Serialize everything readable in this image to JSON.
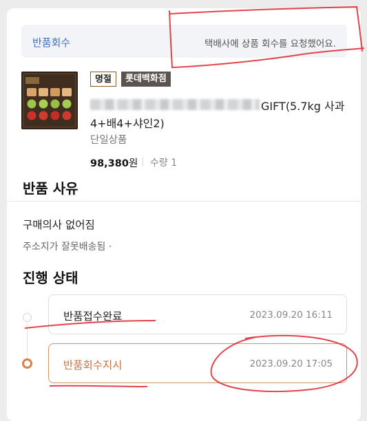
{
  "notice": {
    "label": "반품회수",
    "message": "택배사에 상품 회수를 요청했어요."
  },
  "product": {
    "thumbnail_icon": "gift-box-photo",
    "badges": {
      "brand": "명절",
      "store": "롯데백화점"
    },
    "title_line1": "GIFT(5.7kg 사과",
    "title_line2": "4+배4+샤인2)",
    "option": "단일상품",
    "price_value": "98,380",
    "price_unit": "원",
    "quantity": "수량 1"
  },
  "reason": {
    "heading": "반품 사유",
    "main": "구매의사 없어짐",
    "sub": "주소지가 잘못배송됨 ·"
  },
  "status": {
    "heading": "진행 상태",
    "steps": [
      {
        "label": "반품접수완료",
        "time": "2023.09.20 16:11"
      },
      {
        "label": "반품회수지시",
        "time": "2023.09.20 17:05"
      }
    ]
  },
  "colors": {
    "accent_link": "#3d6fc5",
    "active_step": "#c8743e",
    "annotation_red": "#e0202a"
  }
}
